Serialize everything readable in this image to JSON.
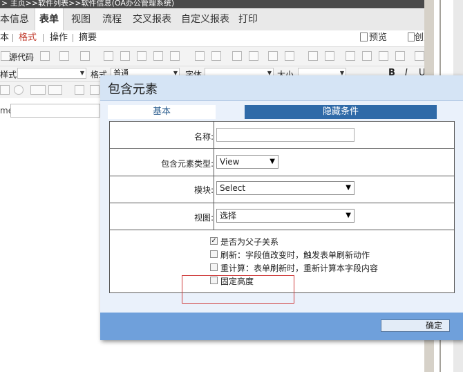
{
  "breadcrumb": "> 主页>>软件列表>>软件信息(OA办公管理系统)",
  "main_tabs": [
    "本信息",
    "表单",
    "视图",
    "流程",
    "交叉报表",
    "自定义报表",
    "打印"
  ],
  "active_main_tab": "表单",
  "sub_tabs": [
    "本",
    "格式",
    "操作",
    "摘要"
  ],
  "active_sub_tab": "格式",
  "actions": {
    "preview": "预览",
    "menu": "创建菜单"
  },
  "toolbar": {
    "source_code": "源代码",
    "style_label": "样式",
    "format_label": "格式",
    "format_value": "普通",
    "font_label": "字体",
    "size_label": "大小"
  },
  "left_name_label": "me:",
  "dialog": {
    "title": "包含元素",
    "tabs": [
      "基本",
      "隐藏条件"
    ],
    "fields": {
      "name_label": "名称:",
      "name_value": "",
      "type_label": "包含元素类型:",
      "type_value": "View",
      "module_label": "模块:",
      "module_value": "Select",
      "view_label": "视图:",
      "view_value": "选择"
    },
    "options": [
      {
        "label": "是否为父子关系",
        "checked": true
      },
      {
        "label": "刷新：字段值改变时，触发表单刷新动作",
        "checked": false
      },
      {
        "label": "重计算：表单刷新时，重新计算本字段内容",
        "checked": false
      },
      {
        "label": "固定高度",
        "checked": false
      }
    ],
    "ok_button": "确定"
  },
  "colors": {
    "title_bg": "#d5e4f5",
    "tab_active": "#2f6aa8",
    "footer": "#6fa0db",
    "highlight": "#cf3b3b"
  }
}
